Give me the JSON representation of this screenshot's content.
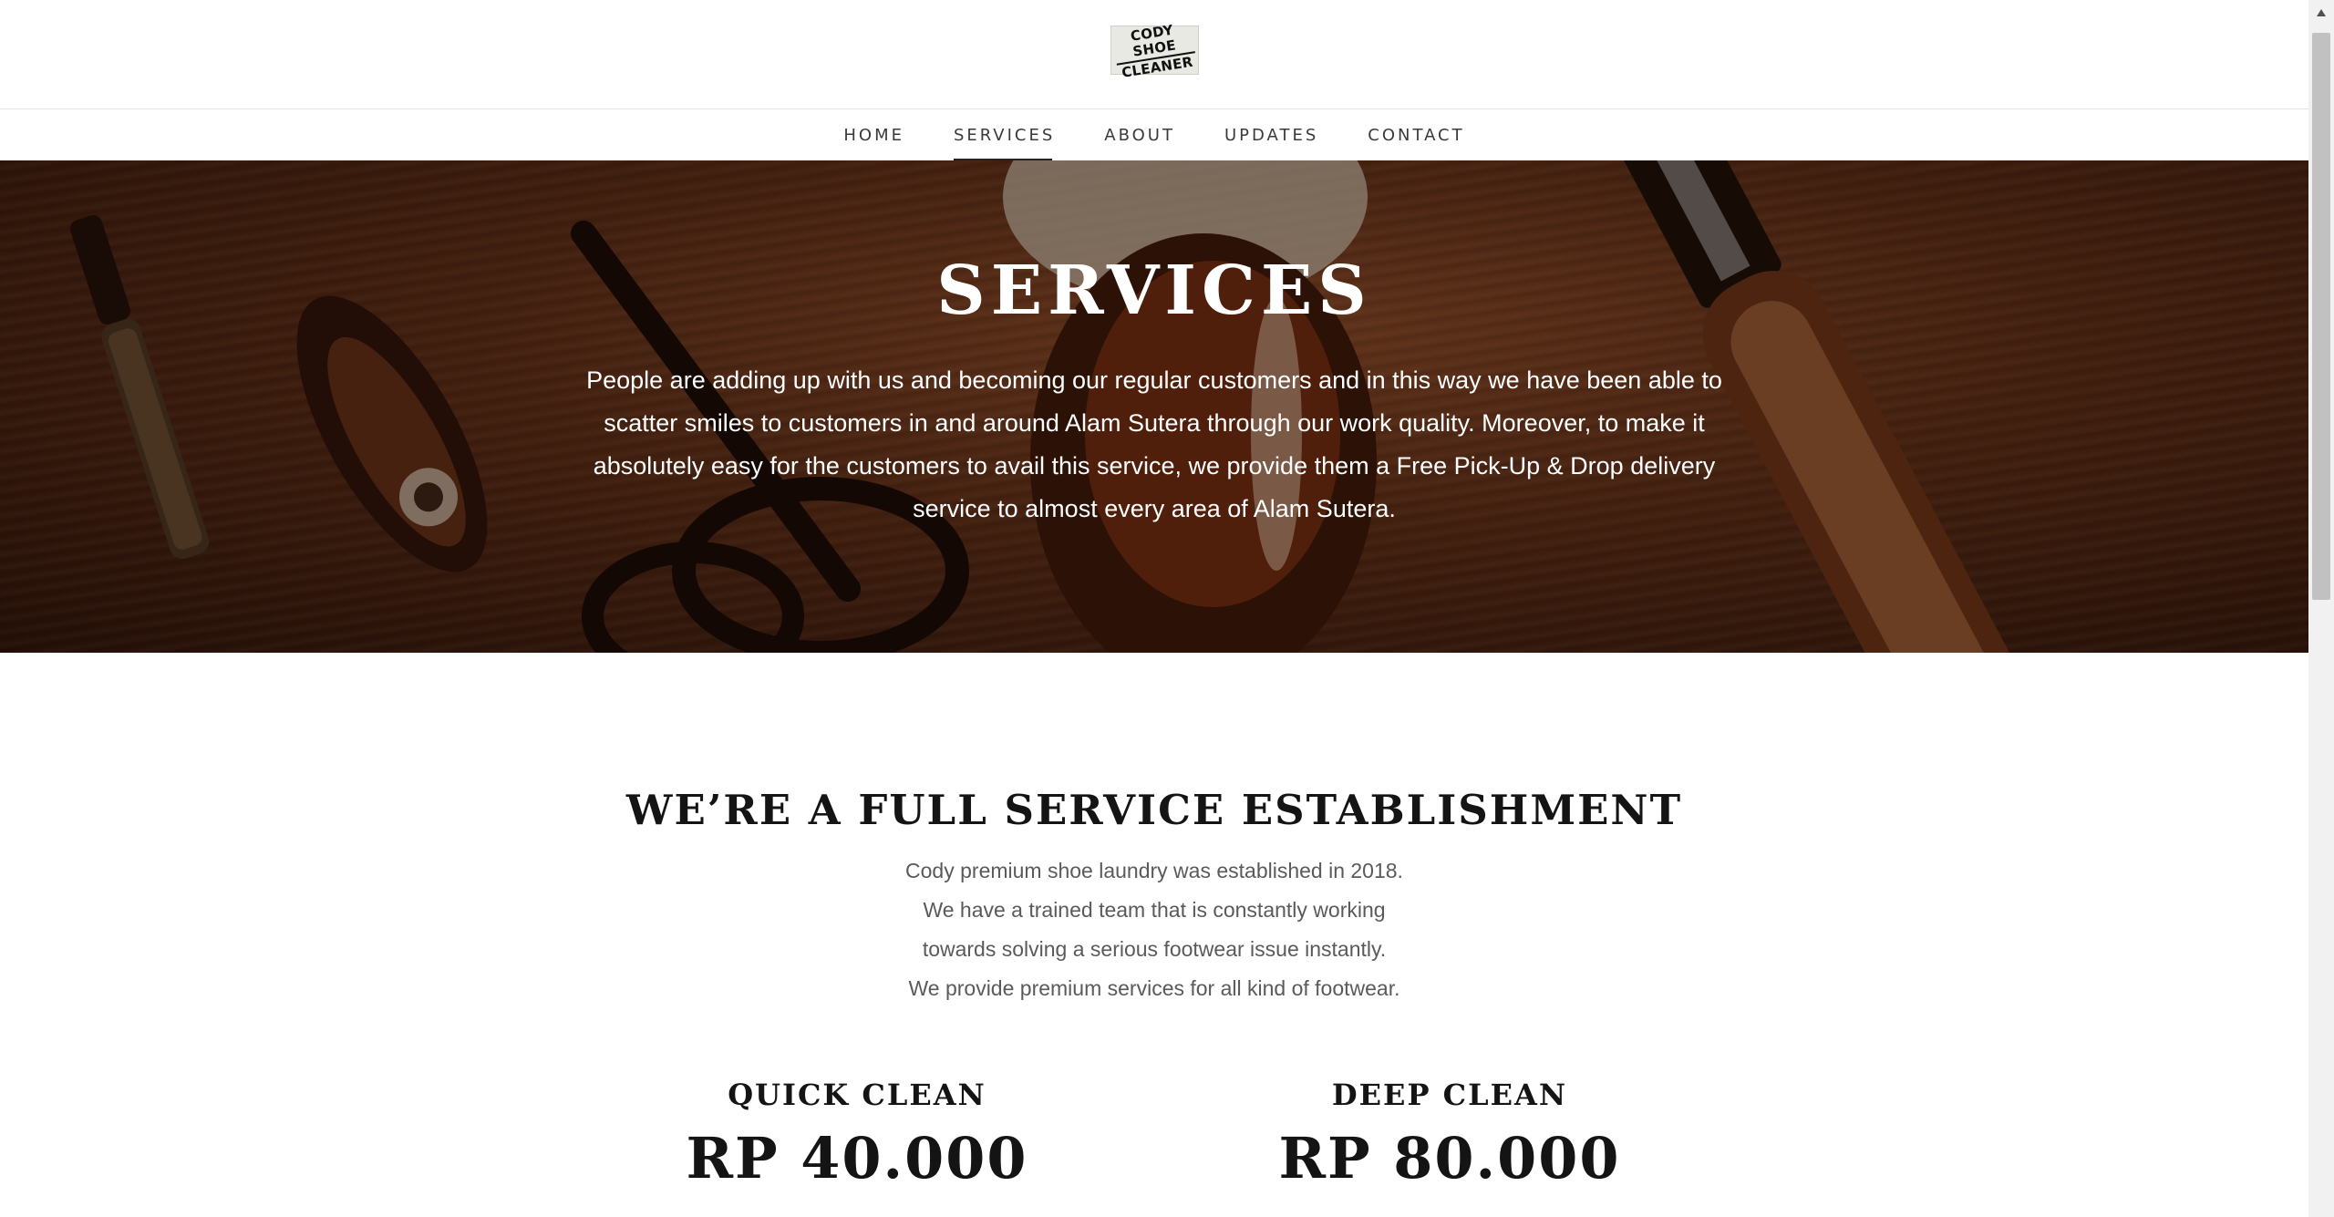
{
  "logo": {
    "line1": "CODY SHOE",
    "line2": "CLEANER"
  },
  "nav": {
    "items": [
      {
        "label": "HOME"
      },
      {
        "label": "SERVICES"
      },
      {
        "label": "ABOUT"
      },
      {
        "label": "UPDATES"
      },
      {
        "label": "CONTACT"
      }
    ],
    "active": "SERVICES"
  },
  "hero": {
    "title": "SERVICES",
    "text": "People are adding up with us and becoming our regular customers and in this way we have been able to scatter smiles to customers in and around Alam Sutera through our work quality. Moreover, to make it absolutely easy for the customers to avail this service, we provide them a Free Pick-Up & Drop delivery service to almost every area of Alam Sutera."
  },
  "section": {
    "title": "WE’RE A FULL SERVICE ESTABLISHMENT",
    "lines": [
      "Cody premium shoe laundry was established in 2018.",
      "We have a trained team that is constantly working",
      "towards solving a serious footwear issue instantly.",
      "We provide premium services for all kind of footwear."
    ]
  },
  "services": [
    {
      "name": "QUICK CLEAN",
      "price": "RP 40.000"
    },
    {
      "name": "DEEP CLEAN",
      "price": "RP 80.000"
    }
  ],
  "colors": {
    "text_dark": "#141414",
    "text_muted": "#5a5a5a",
    "hero_wood": "#5a2c17",
    "scrollbar_thumb": "#c1c1c1"
  },
  "icons": {
    "scroll_up": "triangle-up-icon"
  }
}
